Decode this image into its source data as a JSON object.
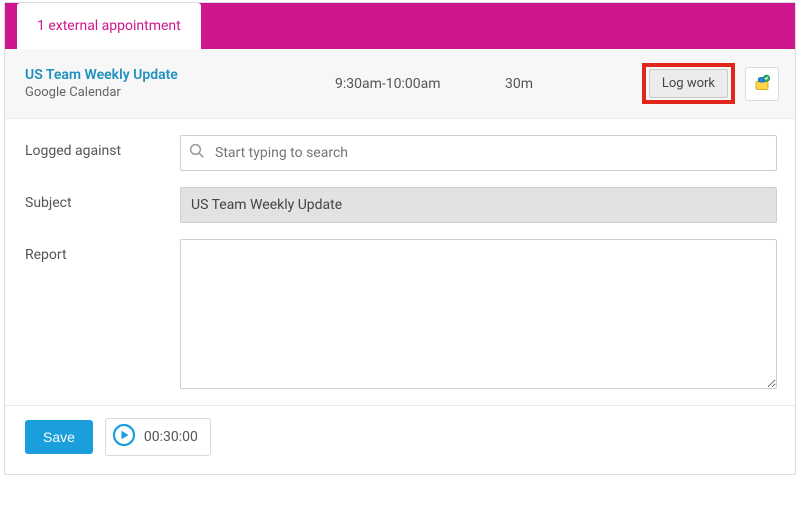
{
  "tab": {
    "label": "1 external appointment"
  },
  "appointment": {
    "title": "US Team Weekly Update",
    "source": "Google Calendar",
    "time": "9:30am-10:00am",
    "duration": "30m",
    "log_work_label": "Log work"
  },
  "form": {
    "logged_against": {
      "label": "Logged against",
      "placeholder": "Start typing to search",
      "value": ""
    },
    "subject": {
      "label": "Subject",
      "value": "US Team Weekly Update"
    },
    "report": {
      "label": "Report",
      "value": ""
    }
  },
  "footer": {
    "save_label": "Save",
    "timer": "00:30:00"
  },
  "colors": {
    "brand": "#cf178d",
    "accent": "#1a9fdc",
    "link": "#2090c0",
    "highlight": "#e1261c"
  }
}
